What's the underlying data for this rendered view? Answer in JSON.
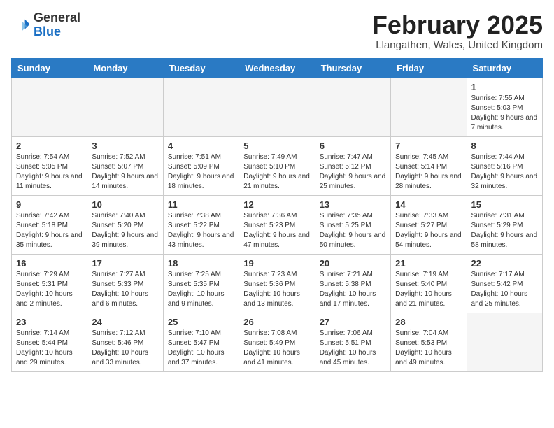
{
  "logo": {
    "general": "General",
    "blue": "Blue"
  },
  "header": {
    "month": "February 2025",
    "location": "Llangathen, Wales, United Kingdom"
  },
  "weekdays": [
    "Sunday",
    "Monday",
    "Tuesday",
    "Wednesday",
    "Thursday",
    "Friday",
    "Saturday"
  ],
  "weeks": [
    [
      {
        "day": "",
        "info": ""
      },
      {
        "day": "",
        "info": ""
      },
      {
        "day": "",
        "info": ""
      },
      {
        "day": "",
        "info": ""
      },
      {
        "day": "",
        "info": ""
      },
      {
        "day": "",
        "info": ""
      },
      {
        "day": "1",
        "info": "Sunrise: 7:55 AM\nSunset: 5:03 PM\nDaylight: 9 hours and 7 minutes."
      }
    ],
    [
      {
        "day": "2",
        "info": "Sunrise: 7:54 AM\nSunset: 5:05 PM\nDaylight: 9 hours and 11 minutes."
      },
      {
        "day": "3",
        "info": "Sunrise: 7:52 AM\nSunset: 5:07 PM\nDaylight: 9 hours and 14 minutes."
      },
      {
        "day": "4",
        "info": "Sunrise: 7:51 AM\nSunset: 5:09 PM\nDaylight: 9 hours and 18 minutes."
      },
      {
        "day": "5",
        "info": "Sunrise: 7:49 AM\nSunset: 5:10 PM\nDaylight: 9 hours and 21 minutes."
      },
      {
        "day": "6",
        "info": "Sunrise: 7:47 AM\nSunset: 5:12 PM\nDaylight: 9 hours and 25 minutes."
      },
      {
        "day": "7",
        "info": "Sunrise: 7:45 AM\nSunset: 5:14 PM\nDaylight: 9 hours and 28 minutes."
      },
      {
        "day": "8",
        "info": "Sunrise: 7:44 AM\nSunset: 5:16 PM\nDaylight: 9 hours and 32 minutes."
      }
    ],
    [
      {
        "day": "9",
        "info": "Sunrise: 7:42 AM\nSunset: 5:18 PM\nDaylight: 9 hours and 35 minutes."
      },
      {
        "day": "10",
        "info": "Sunrise: 7:40 AM\nSunset: 5:20 PM\nDaylight: 9 hours and 39 minutes."
      },
      {
        "day": "11",
        "info": "Sunrise: 7:38 AM\nSunset: 5:22 PM\nDaylight: 9 hours and 43 minutes."
      },
      {
        "day": "12",
        "info": "Sunrise: 7:36 AM\nSunset: 5:23 PM\nDaylight: 9 hours and 47 minutes."
      },
      {
        "day": "13",
        "info": "Sunrise: 7:35 AM\nSunset: 5:25 PM\nDaylight: 9 hours and 50 minutes."
      },
      {
        "day": "14",
        "info": "Sunrise: 7:33 AM\nSunset: 5:27 PM\nDaylight: 9 hours and 54 minutes."
      },
      {
        "day": "15",
        "info": "Sunrise: 7:31 AM\nSunset: 5:29 PM\nDaylight: 9 hours and 58 minutes."
      }
    ],
    [
      {
        "day": "16",
        "info": "Sunrise: 7:29 AM\nSunset: 5:31 PM\nDaylight: 10 hours and 2 minutes."
      },
      {
        "day": "17",
        "info": "Sunrise: 7:27 AM\nSunset: 5:33 PM\nDaylight: 10 hours and 6 minutes."
      },
      {
        "day": "18",
        "info": "Sunrise: 7:25 AM\nSunset: 5:35 PM\nDaylight: 10 hours and 9 minutes."
      },
      {
        "day": "19",
        "info": "Sunrise: 7:23 AM\nSunset: 5:36 PM\nDaylight: 10 hours and 13 minutes."
      },
      {
        "day": "20",
        "info": "Sunrise: 7:21 AM\nSunset: 5:38 PM\nDaylight: 10 hours and 17 minutes."
      },
      {
        "day": "21",
        "info": "Sunrise: 7:19 AM\nSunset: 5:40 PM\nDaylight: 10 hours and 21 minutes."
      },
      {
        "day": "22",
        "info": "Sunrise: 7:17 AM\nSunset: 5:42 PM\nDaylight: 10 hours and 25 minutes."
      }
    ],
    [
      {
        "day": "23",
        "info": "Sunrise: 7:14 AM\nSunset: 5:44 PM\nDaylight: 10 hours and 29 minutes."
      },
      {
        "day": "24",
        "info": "Sunrise: 7:12 AM\nSunset: 5:46 PM\nDaylight: 10 hours and 33 minutes."
      },
      {
        "day": "25",
        "info": "Sunrise: 7:10 AM\nSunset: 5:47 PM\nDaylight: 10 hours and 37 minutes."
      },
      {
        "day": "26",
        "info": "Sunrise: 7:08 AM\nSunset: 5:49 PM\nDaylight: 10 hours and 41 minutes."
      },
      {
        "day": "27",
        "info": "Sunrise: 7:06 AM\nSunset: 5:51 PM\nDaylight: 10 hours and 45 minutes."
      },
      {
        "day": "28",
        "info": "Sunrise: 7:04 AM\nSunset: 5:53 PM\nDaylight: 10 hours and 49 minutes."
      },
      {
        "day": "",
        "info": ""
      }
    ]
  ]
}
